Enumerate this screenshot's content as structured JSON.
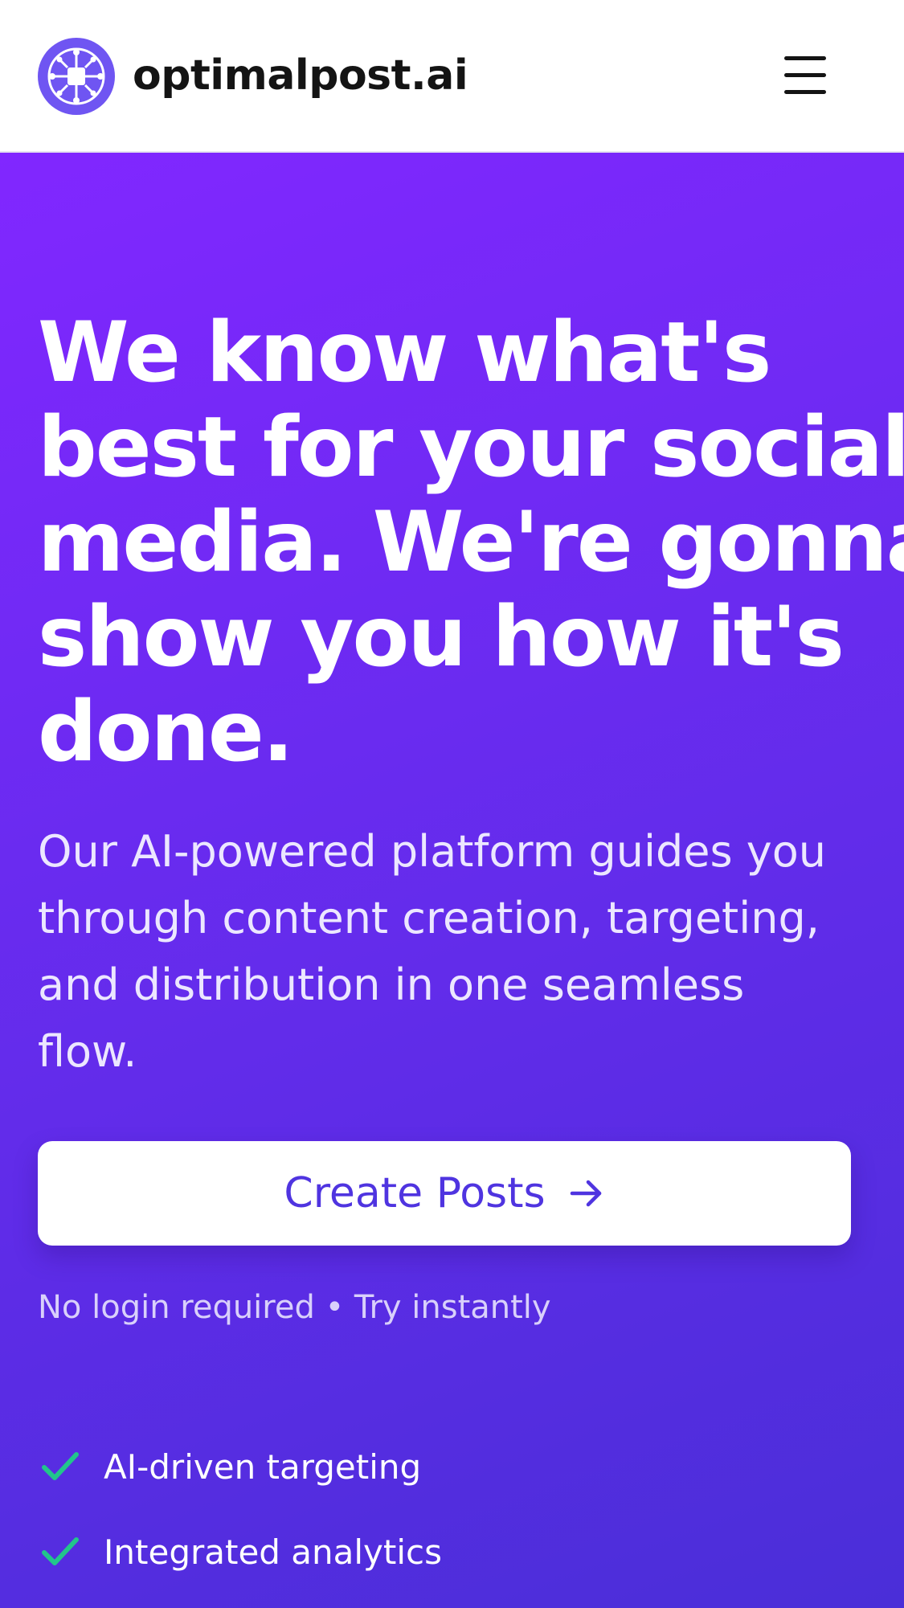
{
  "header": {
    "brand_name": "optimalpost.ai",
    "logo_icon": "circuit-chip-icon",
    "menu_icon": "hamburger-menu-icon"
  },
  "hero": {
    "title_lines": [
      "We know what's",
      "best for your social",
      "media. We're gonna",
      "show you how it's",
      "done."
    ],
    "subtitle_lines": [
      "Our AI-powered platform guides you",
      "through content creation, targeting,",
      "and distribution in one seamless",
      "flow."
    ],
    "cta_label": "Create Posts",
    "cta_icon": "arrow-right-icon",
    "note": "No login required • Try instantly",
    "features": [
      {
        "label": "AI-driven targeting",
        "icon": "check-icon"
      },
      {
        "label": "Integrated analytics",
        "icon": "check-icon"
      }
    ]
  },
  "colors": {
    "brand_purple": "#7b5cf5",
    "gradient_start": "#8127ff",
    "gradient_end": "#4a2ed8",
    "cta_text": "#4f34e0",
    "check_green": "#22c58b"
  }
}
